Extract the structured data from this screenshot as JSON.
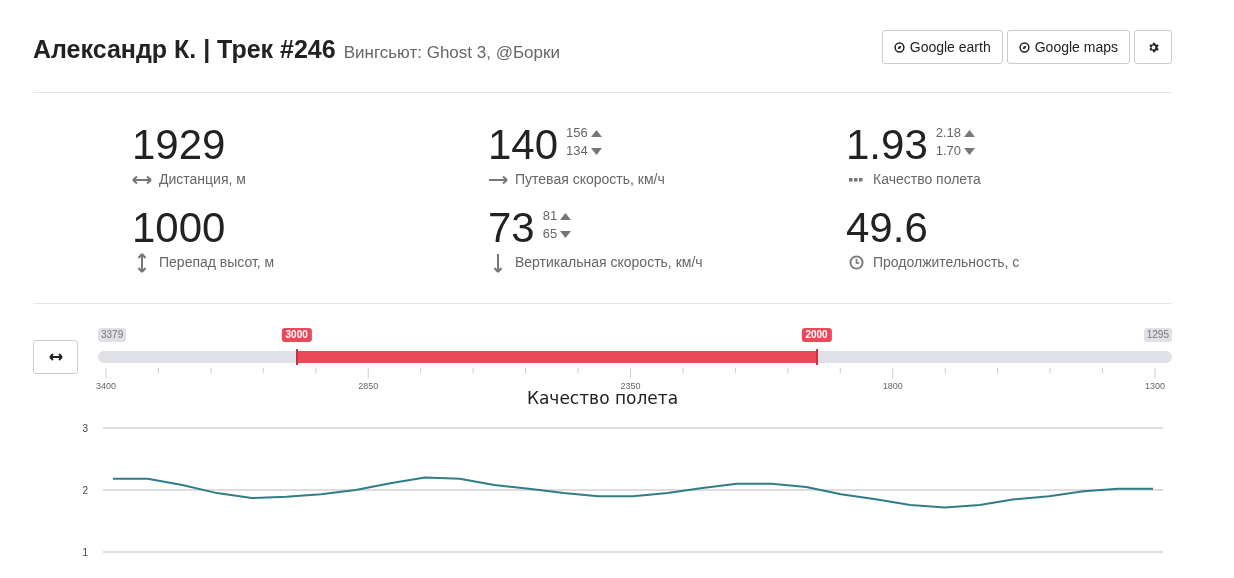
{
  "header": {
    "title": "Александр К. | Трек #246",
    "subtitle": "Вингсьют: Ghost 3, @Борки",
    "buttons": [
      {
        "kind": "compass",
        "label": "Google earth"
      },
      {
        "kind": "compass",
        "label": "Google maps"
      },
      {
        "kind": "settings"
      }
    ]
  },
  "stats": [
    {
      "kind": "horizontal",
      "value": "1929",
      "label": "Дистанция, м"
    },
    {
      "kind": "right",
      "value": "140",
      "max": "156",
      "min": "134",
      "label": "Путевая скорость, км/ч"
    },
    {
      "kind": "dots",
      "value": "1.93",
      "max": "2.18",
      "min": "1.70",
      "label": "Качество полета"
    },
    {
      "kind": "vertical",
      "value": "1000",
      "label": "Перепад высот, м"
    },
    {
      "kind": "down",
      "value": "73",
      "max": "81",
      "min": "65",
      "label": "Вертикальная скорость, км/ч"
    },
    {
      "kind": "clock",
      "value": "49.6",
      "label": "Продолжительность, с"
    }
  ],
  "range": {
    "min_label": "3379",
    "max_label": "1295",
    "handles": [
      {
        "label": "3000",
        "level": 0.185
      },
      {
        "label": "2000",
        "level": 0.669
      }
    ],
    "ticks": [
      "3400",
      "2850",
      "2350",
      "1800",
      "1300"
    ]
  },
  "chart": {
    "chart_data": {
      "type": "line",
      "title": "Качество полета",
      "ylim": [
        1,
        3
      ],
      "yticks": [
        1,
        2,
        3
      ],
      "series": [
        {
          "color": "#2e7d87",
          "values": [
            2.18,
            2.18,
            2.08,
            1.95,
            1.87,
            1.89,
            1.93,
            2.0,
            2.11,
            2.2,
            2.18,
            2.08,
            2.02,
            1.95,
            1.9,
            1.9,
            1.95,
            2.03,
            2.1,
            2.1,
            2.05,
            1.93,
            1.85,
            1.76,
            1.72,
            1.76,
            1.85,
            1.9,
            1.98,
            2.02,
            2.02
          ]
        }
      ]
    }
  }
}
